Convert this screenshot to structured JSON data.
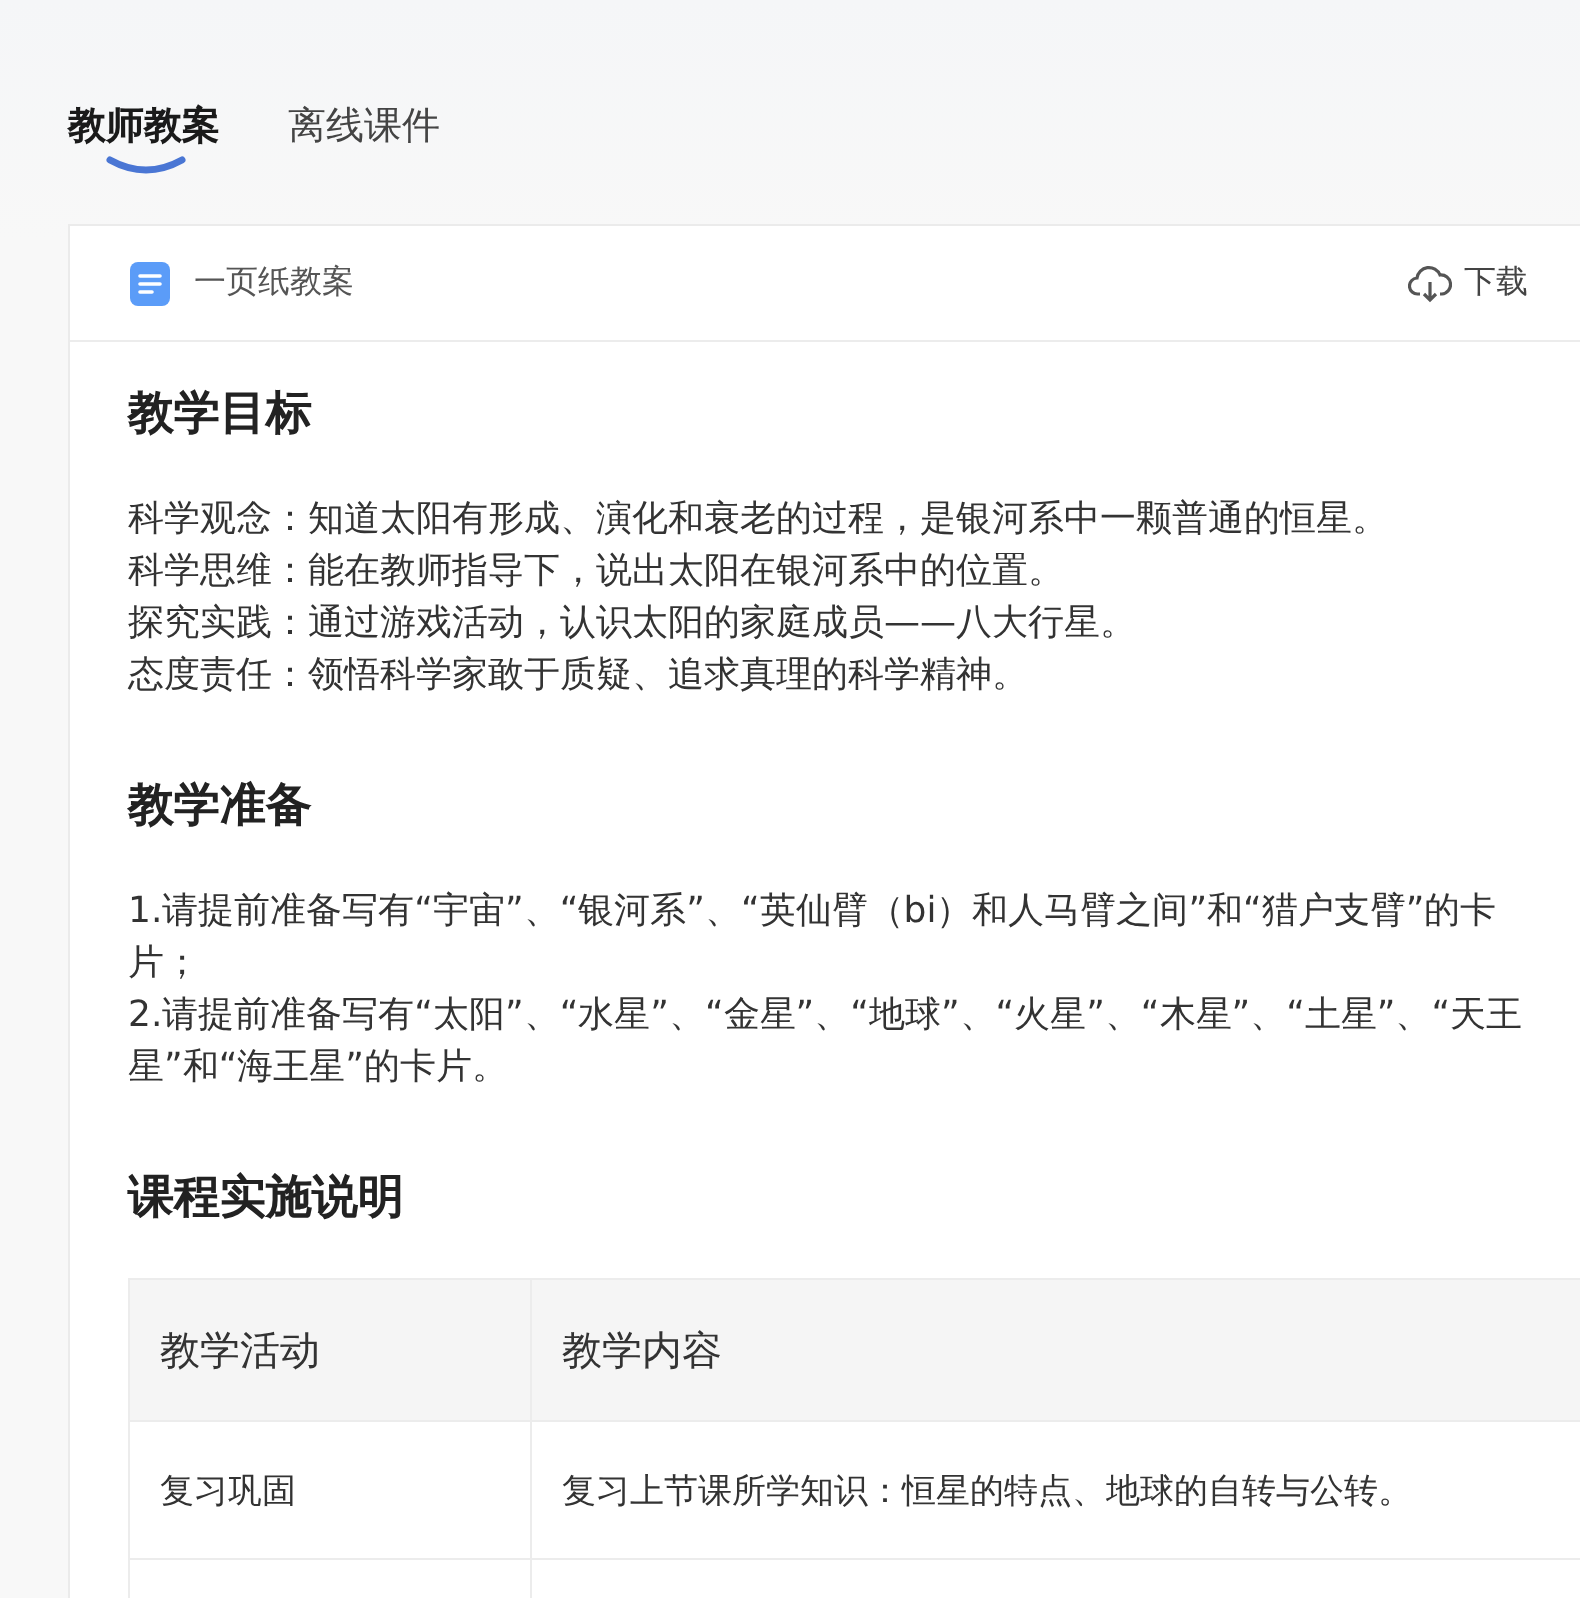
{
  "tabs": [
    {
      "label": "教师教案",
      "selected": true
    },
    {
      "label": "离线课件",
      "selected": false
    }
  ],
  "doc_header": {
    "title": "一页纸教案",
    "download": "下载"
  },
  "sections": [
    {
      "heading": "教学目标",
      "paragraphs": [
        "科学观念：知道太阳有形成、演化和衰老的过程，是银河系中一颗普通的恒星。",
        "科学思维：能在教师指导下，说出太阳在银河系中的位置。",
        "探究实践：通过游戏活动，认识太阳的家庭成员——八大行星。",
        "态度责任：领悟科学家敢于质疑、追求真理的科学精神。"
      ]
    },
    {
      "heading": "教学准备",
      "paragraphs": [
        "1.请提前准备写有“宇宙”、“银河系”、“英仙臂（bi）和人马臂之间”和“猎户支臂”的卡片；",
        "2.请提前准备写有“太阳”、“水星”、“金星”、“地球”、“火星”、“木星”、“土星”、“天王星”和“海王星”的卡片。"
      ]
    },
    {
      "heading": "课程实施说明",
      "table": {
        "columns": [
          "教学活动",
          "教学内容"
        ],
        "rows": [
          [
            "复习巩固",
            "复习上节课所学知识：恒星的特点、地球的自转与公转。"
          ]
        ]
      }
    }
  ]
}
